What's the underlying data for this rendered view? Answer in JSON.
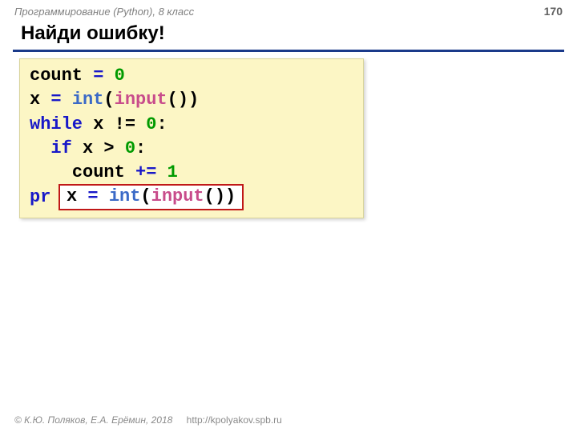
{
  "header": {
    "course": "Программирование (Python), 8 класс",
    "page": "170"
  },
  "title": "Найди ошибку!",
  "code": {
    "l1a": "count ",
    "l1_eq": "=",
    "l1_sp": " ",
    "l1_zero": "0",
    "l2a": "x ",
    "l2_eq": "=",
    "l2_sp": " ",
    "l2_int": "int",
    "l2_par1": "(",
    "l2_input": "input",
    "l2_par2": "())",
    "l3_while": "while",
    "l3_rest": " x != ",
    "l3_zero": "0",
    "l3_colon": ":",
    "l4_pad": "  ",
    "l4_if": "if",
    "l4_mid": " x > ",
    "l4_zero": "0",
    "l4_colon": ":",
    "l5_pad": "    ",
    "l5a": "count ",
    "l5_eq": "+=",
    "l5_sp": " ",
    "l5_one": "1",
    "l6_pr": "pr"
  },
  "answer": {
    "a_x": "x ",
    "a_eq": "=",
    "a_sp": " ",
    "a_int": "int",
    "a_p1": "(",
    "a_input": "input",
    "a_p2": "())"
  },
  "footer": {
    "copyright": "© К.Ю. Поляков, Е.А. Ерёмин, 2018",
    "url": "http://kpolyakov.spb.ru"
  }
}
